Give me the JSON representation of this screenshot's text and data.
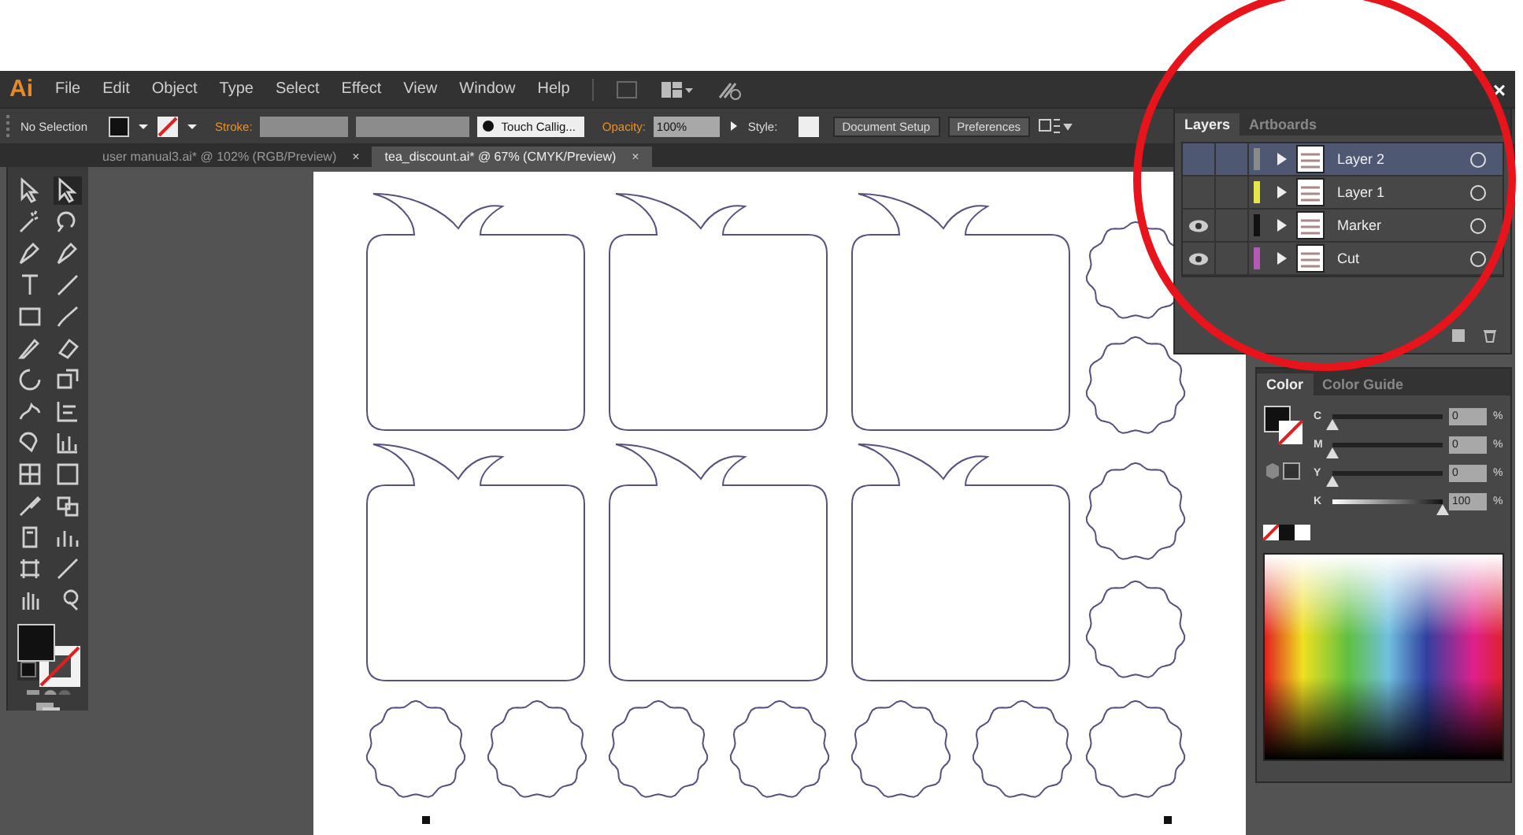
{
  "menu_bar": {
    "logo": "Ai",
    "items": [
      "File",
      "Edit",
      "Object",
      "Type",
      "Select",
      "Effect",
      "View",
      "Window",
      "Help"
    ],
    "close": "×"
  },
  "control_bar": {
    "selection": "No Selection",
    "stroke_label": "Stroke:",
    "brush": "Touch Callig...",
    "opacity_label": "Opacity:",
    "opacity": "100%",
    "style_label": "Style:",
    "buttons": [
      "Document Setup",
      "Preferences"
    ]
  },
  "tabs": [
    {
      "label": "user manual3.ai* @ 102% (RGB/Preview)",
      "close": "×",
      "selected": false
    },
    {
      "label": "tea_discount.ai* @ 67% (CMYK/Preview)",
      "close": "×",
      "selected": true
    }
  ],
  "layers_panel": {
    "tabs": [
      {
        "label": "Layers",
        "selected": true
      },
      {
        "label": "Artboards",
        "selected": false
      }
    ],
    "layers": [
      {
        "name": "Layer 2",
        "visible": false,
        "color": "#8a8a8a",
        "selected": true
      },
      {
        "name": "Layer 1",
        "visible": false,
        "color": "#e6e64a",
        "selected": false
      },
      {
        "name": "Marker",
        "visible": true,
        "color": "#111111",
        "selected": false
      },
      {
        "name": "Cut",
        "visible": true,
        "color": "#b45ab4",
        "selected": false
      }
    ]
  },
  "color_panel": {
    "tabs": [
      {
        "label": "Color",
        "selected": true
      },
      {
        "label": "Color Guide",
        "selected": false
      }
    ],
    "channels": [
      {
        "name": "C",
        "value": "0",
        "unit": "%",
        "level": 0
      },
      {
        "name": "M",
        "value": "0",
        "unit": "%",
        "level": 0
      },
      {
        "name": "Y",
        "value": "0",
        "unit": "%",
        "level": 0
      },
      {
        "name": "K",
        "value": "100",
        "unit": "%",
        "level": 1
      }
    ]
  }
}
